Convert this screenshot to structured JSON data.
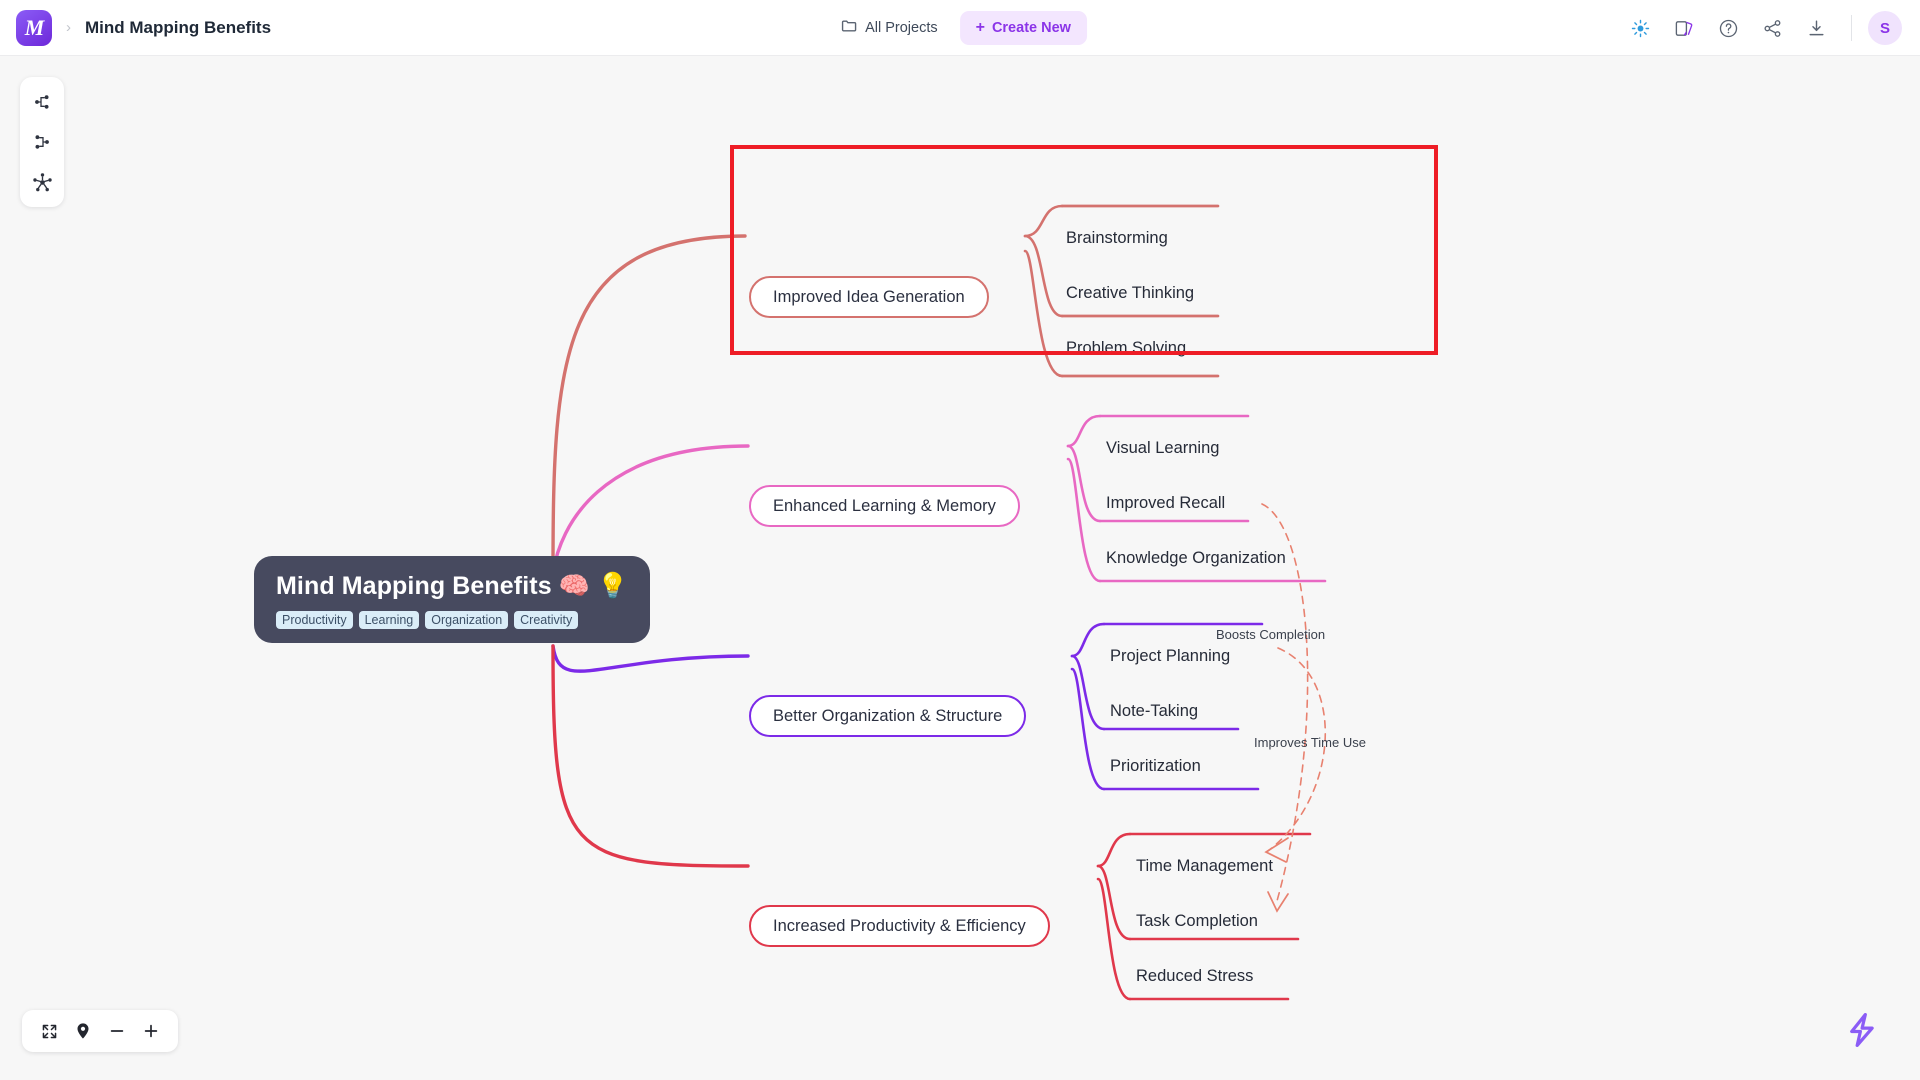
{
  "header": {
    "logo_glyph": "M",
    "logo_name": "app-logo",
    "breadcrumb_separator": "›",
    "document_title": "Mind Mapping Benefits",
    "all_projects_label": "All Projects",
    "create_new_label": "Create New",
    "create_new_plus": "+",
    "avatar_initial": "S",
    "icons": [
      "ai-sparkle-icon",
      "theme-palette-icon",
      "help-circle-icon",
      "share-icon",
      "download-icon"
    ],
    "accent_purple": "#8b34e8",
    "create_new_bg": "#f3e6fe"
  },
  "left_toolbar": {
    "items": [
      {
        "name": "layout-right-tree-icon",
        "label": "Right tree layout"
      },
      {
        "name": "layout-left-tree-icon",
        "label": "Left tree layout"
      },
      {
        "name": "layout-radial-icon",
        "label": "Radial layout"
      }
    ]
  },
  "zoom_bar": {
    "items": [
      {
        "name": "fit-to-screen-button",
        "label": "Fit to screen"
      },
      {
        "name": "center-map-button",
        "label": "Center map"
      },
      {
        "name": "zoom-out-button",
        "label": "−"
      },
      {
        "name": "zoom-in-button",
        "label": "+"
      }
    ]
  },
  "quick_action": {
    "name": "lightning-bolt-icon",
    "color": "#8b5cf6"
  },
  "mindmap": {
    "root": {
      "title": "Mind Mapping Benefits 🧠 💡",
      "tags": [
        "Productivity",
        "Learning",
        "Organization",
        "Creativity"
      ],
      "bg": "#474a5f"
    },
    "branches": [
      {
        "label": "Improved Idea Generation",
        "color": "#d4726e",
        "highlighted": true,
        "children": [
          "Brainstorming",
          "Creative Thinking",
          "Problem Solving"
        ]
      },
      {
        "label": "Enhanced Learning & Memory",
        "color": "#e868c3",
        "highlighted": false,
        "children": [
          "Visual Learning",
          "Improved Recall",
          "Knowledge Organization"
        ]
      },
      {
        "label": "Better Organization & Structure",
        "color": "#7c2ae8",
        "highlighted": false,
        "children": [
          "Project Planning",
          "Note-Taking",
          "Prioritization"
        ]
      },
      {
        "label": "Increased Productivity & Efficiency",
        "color": "#e0384b",
        "highlighted": false,
        "children": [
          "Time Management",
          "Task Completion",
          "Reduced Stress"
        ]
      }
    ],
    "cross_links": [
      {
        "label": "Boosts Completion",
        "from": "Improved Recall",
        "to": "Task Completion"
      },
      {
        "label": "Improves Time Use",
        "from": "Project Planning",
        "to": "Time Management"
      }
    ],
    "highlight_color": "#ee1d26"
  }
}
